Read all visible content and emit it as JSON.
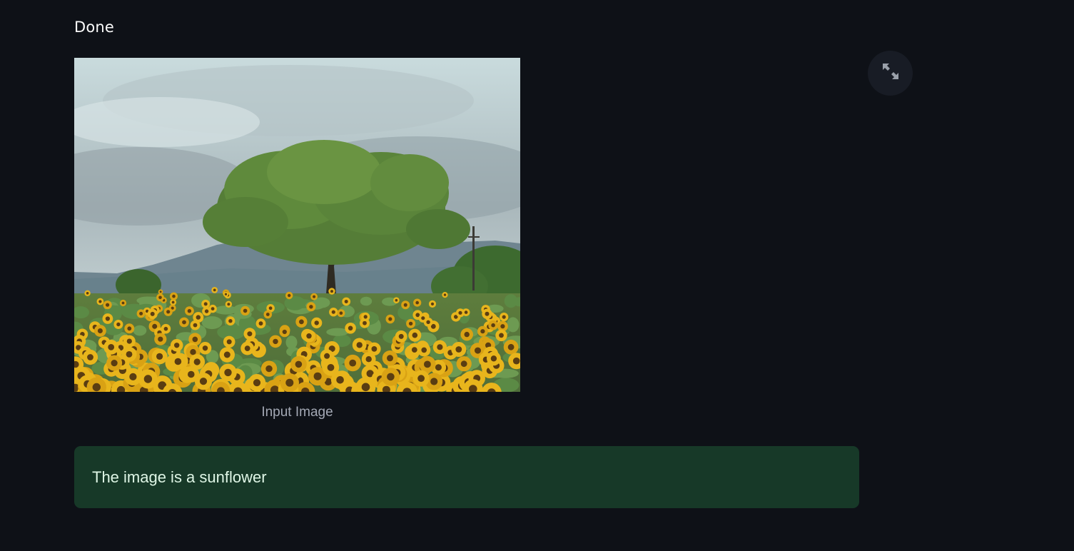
{
  "status": {
    "text": "Done"
  },
  "image": {
    "caption": "Input Image",
    "alt_icon": "sunflower-field-photo"
  },
  "fullscreen_button": {
    "icon": "expand-icon"
  },
  "result": {
    "text": "The image is a sunflower"
  },
  "colors": {
    "background": "#0e1117",
    "result_bg": "#173928",
    "result_text": "#dff6e6",
    "caption_text": "#a3a8b4",
    "button_bg": "#181c25"
  }
}
